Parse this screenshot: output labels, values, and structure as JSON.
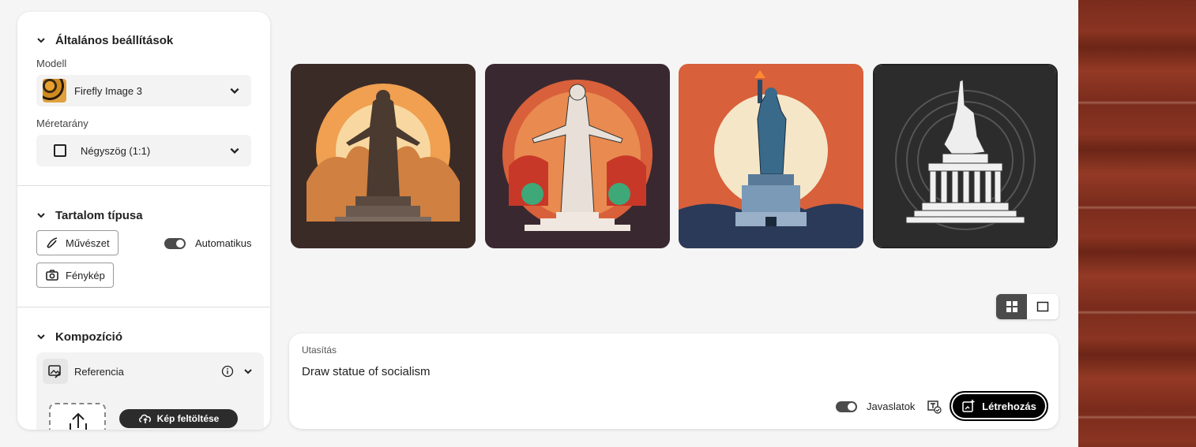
{
  "settings": {
    "general_title": "Általános beállítások",
    "model_label": "Modell",
    "model_value": "Firefly Image 3",
    "aspect_label": "Méretarány",
    "aspect_value": "Négyszög (1:1)"
  },
  "content_type": {
    "title": "Tartalom típusa",
    "art_label": "Művészet",
    "photo_label": "Fénykép",
    "auto_label": "Automatikus",
    "auto_on": true
  },
  "composition": {
    "title": "Kompozíció",
    "reference_label": "Referencia",
    "upload_label": "Kép feltöltése"
  },
  "gallery": {
    "images": [
      {
        "icon": "statue-golden-sunset-image"
      },
      {
        "icon": "statue-toga-orange-circle-image"
      },
      {
        "icon": "statue-of-liberty-image"
      },
      {
        "icon": "statue-monochrome-image"
      }
    ],
    "view_mode": "grid"
  },
  "prompt": {
    "label": "Utasítás",
    "text": "Draw statue of socialism",
    "suggestions_label": "Javaslatok",
    "suggestions_on": true,
    "create_label": "Létrehozás"
  }
}
